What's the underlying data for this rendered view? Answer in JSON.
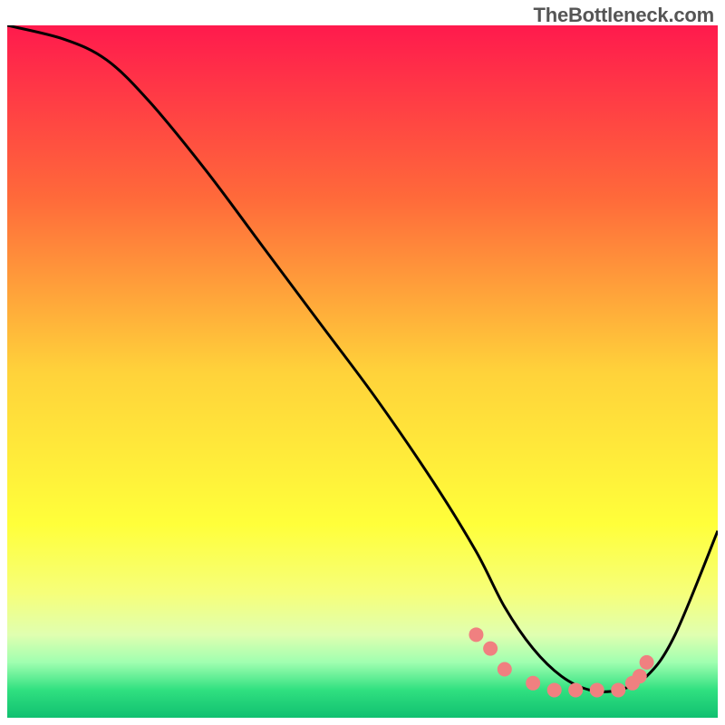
{
  "watermark": "TheBottleneck.com",
  "chart_data": {
    "type": "line",
    "title": "",
    "xlabel": "",
    "ylabel": "",
    "xlim": [
      0,
      100
    ],
    "ylim": [
      0,
      100
    ],
    "gradient_stops": [
      {
        "offset": 0,
        "color": "#ff1a4d"
      },
      {
        "offset": 25,
        "color": "#ff6a3a"
      },
      {
        "offset": 50,
        "color": "#ffd23a"
      },
      {
        "offset": 72,
        "color": "#ffff3a"
      },
      {
        "offset": 82,
        "color": "#f6ff7a"
      },
      {
        "offset": 88,
        "color": "#e0ffb0"
      },
      {
        "offset": 92,
        "color": "#a0ffb0"
      },
      {
        "offset": 96,
        "color": "#30e080"
      },
      {
        "offset": 100,
        "color": "#10c070"
      }
    ],
    "series": [
      {
        "name": "curve",
        "x": [
          0,
          8,
          14,
          20,
          28,
          36,
          44,
          52,
          60,
          66,
          70,
          74,
          78,
          82,
          86,
          90,
          94,
          100
        ],
        "y": [
          100,
          98,
          95,
          89,
          79,
          68,
          57,
          46,
          34,
          24,
          16,
          10,
          6,
          4,
          4,
          6,
          12,
          27
        ]
      }
    ],
    "markers": {
      "name": "points",
      "color": "#f08080",
      "x": [
        66,
        68,
        70,
        74,
        77,
        80,
        83,
        86,
        88,
        89,
        90
      ],
      "y": [
        12,
        10,
        7,
        5,
        4,
        4,
        4,
        4,
        5,
        6,
        8
      ]
    }
  }
}
